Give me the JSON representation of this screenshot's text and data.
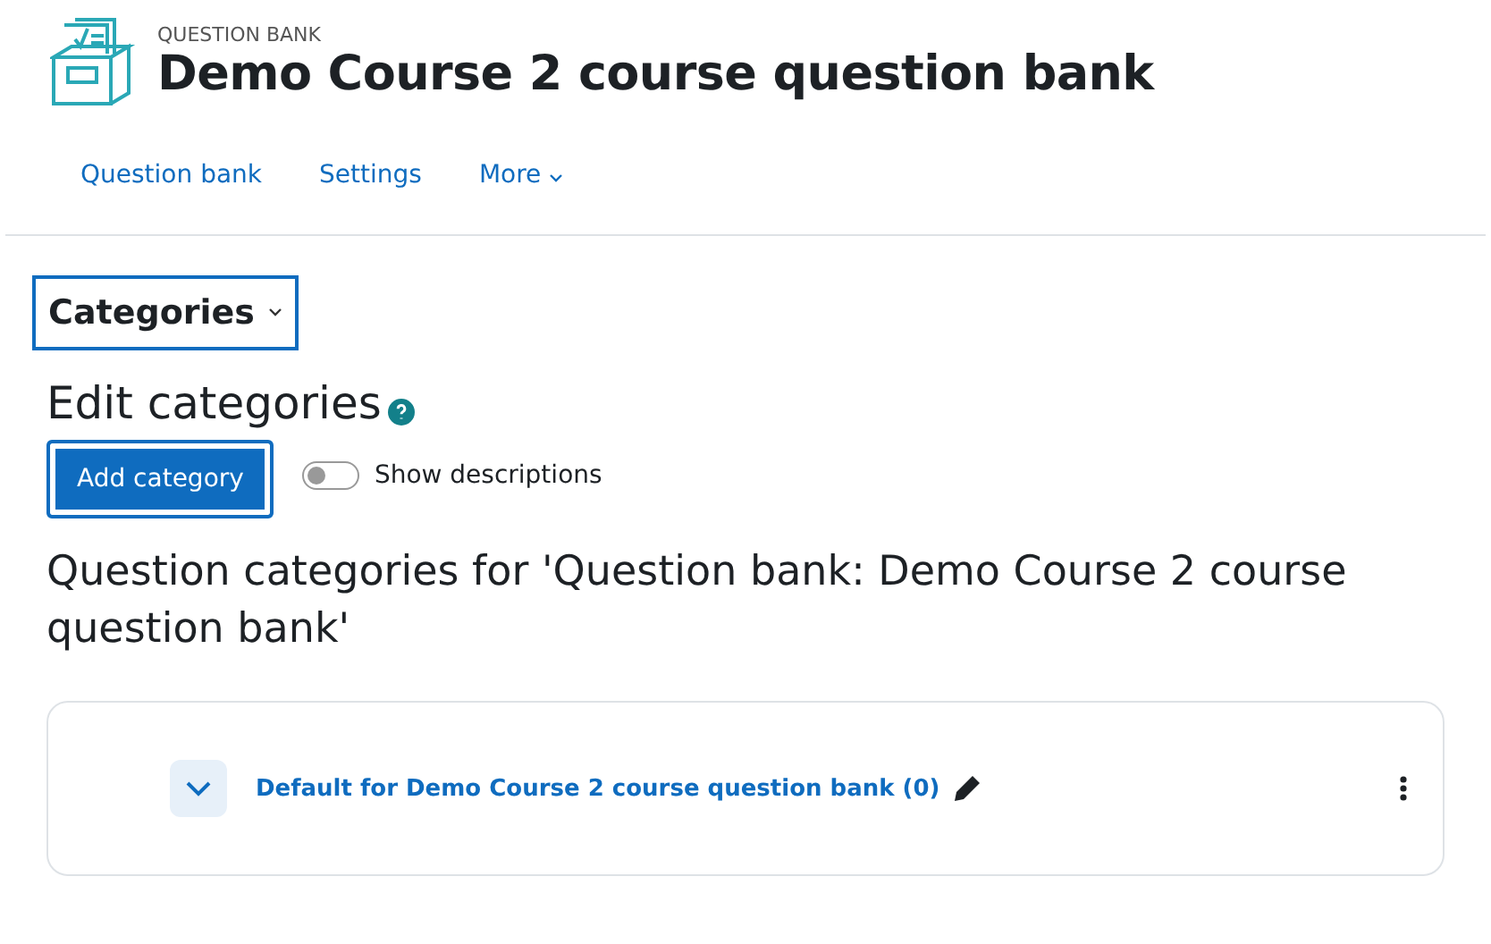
{
  "header": {
    "label": "QUESTION BANK",
    "title": "Demo Course 2 course question bank"
  },
  "nav": [
    {
      "label": "Question bank",
      "kind": "link"
    },
    {
      "label": "Settings",
      "kind": "link"
    },
    {
      "label": "More",
      "kind": "menu"
    }
  ],
  "section_menu": {
    "label": "Categories",
    "focused": true
  },
  "heading": "Edit categories",
  "add_button": {
    "label": "Add category",
    "focused": true
  },
  "toggle": {
    "label": "Show descriptions",
    "on": false
  },
  "subheading": "Question categories for 'Question bank: Demo Course 2 course question bank'",
  "categories": [
    {
      "name": "Default for Demo Course 2 course question bank (0)"
    }
  ]
}
